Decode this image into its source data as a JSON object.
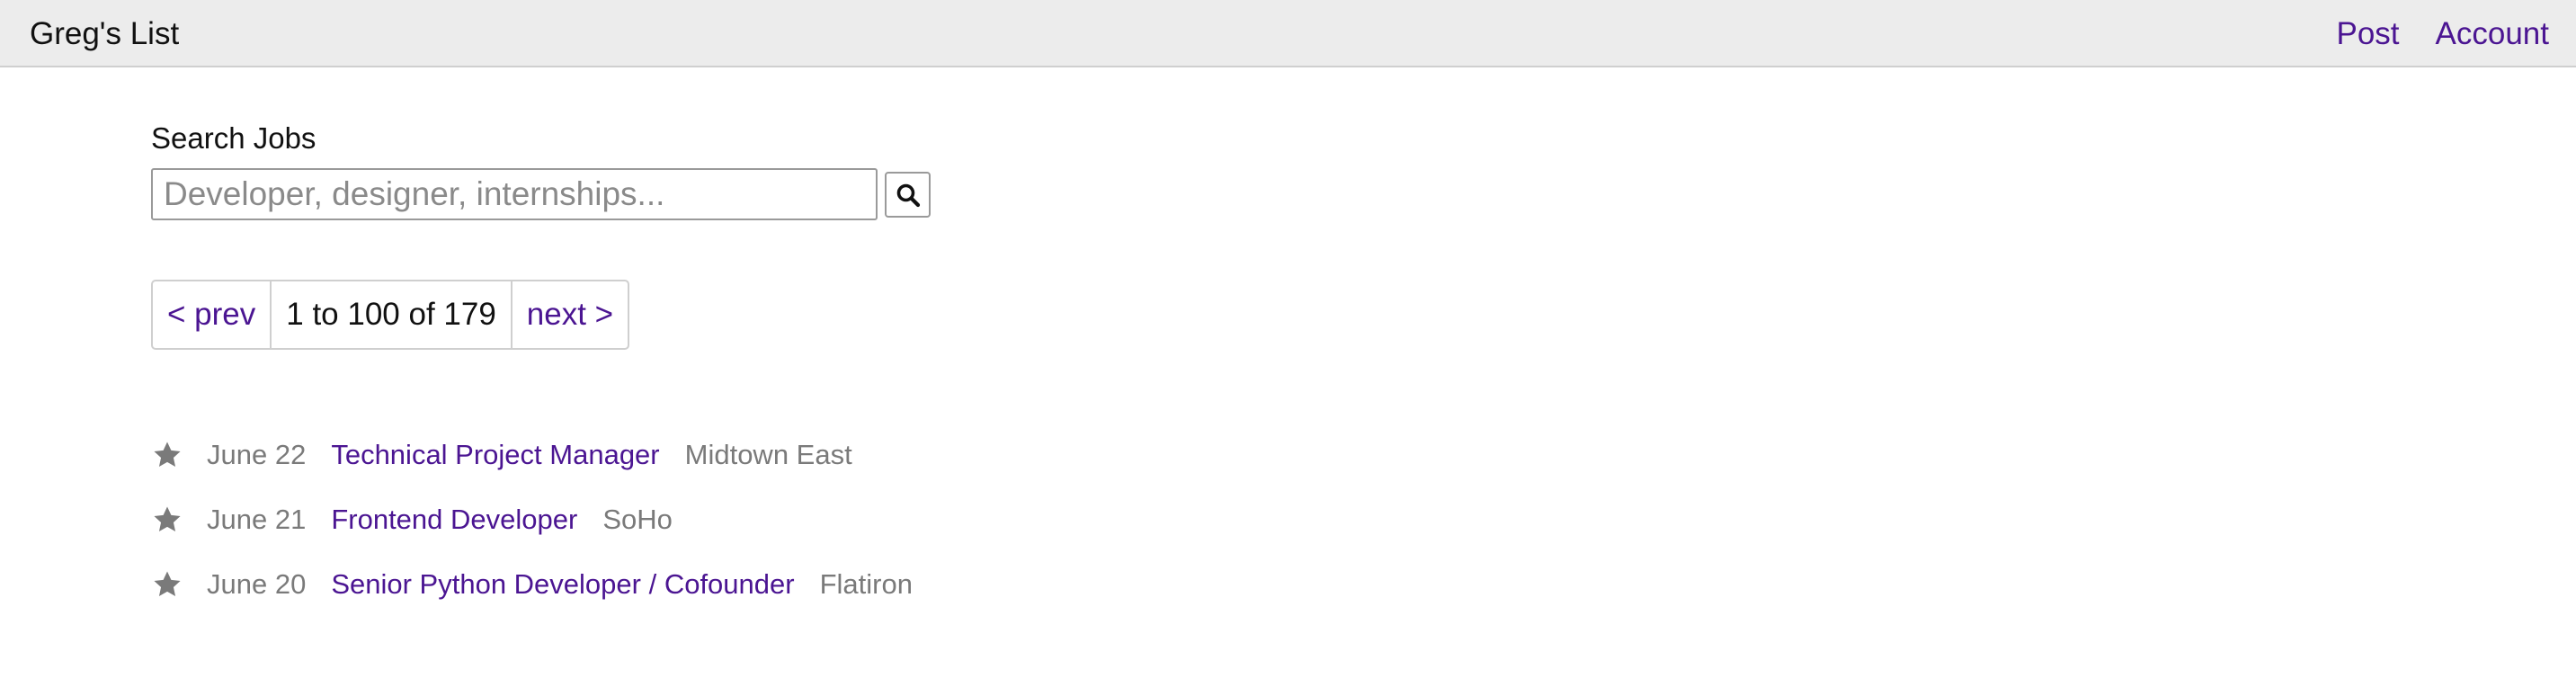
{
  "header": {
    "brand": "Greg's List",
    "nav": [
      {
        "label": "Post"
      },
      {
        "label": "Account"
      }
    ]
  },
  "search": {
    "label": "Search Jobs",
    "value": "",
    "placeholder": "Developer, designer, internships...",
    "button_icon": "search-icon"
  },
  "pagination": {
    "prev_label": "< prev",
    "range_label": "1 to 100 of 179",
    "next_label": "next >"
  },
  "jobs": [
    {
      "date": "June 22",
      "title": "Technical Project Manager",
      "location": "Midtown East",
      "icon": "star-icon"
    },
    {
      "date": "June 21",
      "title": "Frontend Developer",
      "location": "SoHo",
      "icon": "star-icon"
    },
    {
      "date": "June 20",
      "title": "Senior Python Developer / Cofounder",
      "location": "Flatiron",
      "icon": "star-icon"
    }
  ],
  "colors": {
    "link": "#4b1592",
    "header_bg": "#ececec",
    "muted_text": "#7a7a7a",
    "star": "#7a7a7a"
  }
}
